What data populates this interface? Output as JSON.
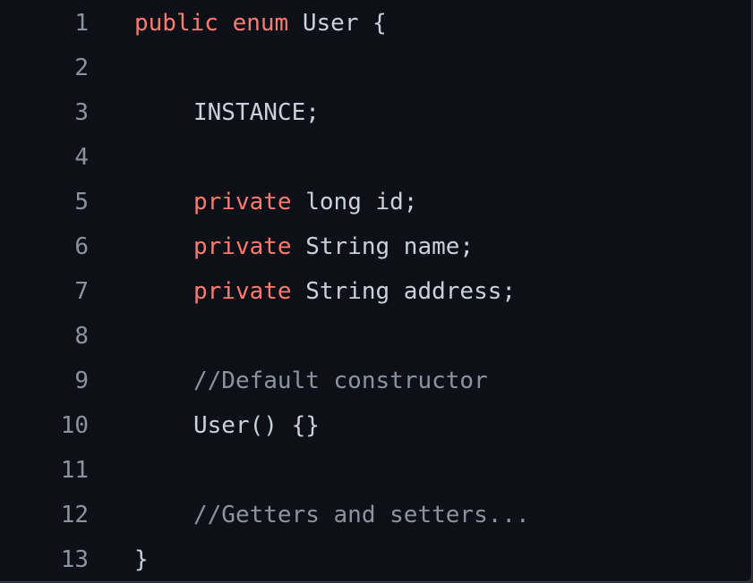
{
  "theme": {
    "background": "#0d1117",
    "line_number_color": "#8b949e",
    "keyword_color": "#ff7b72",
    "text_color": "#c9d1d9",
    "comment_color": "#8b949e"
  },
  "code": {
    "language": "java",
    "lines": [
      {
        "number": "1",
        "tokens": [
          {
            "type": "keyword",
            "text": "public"
          },
          {
            "type": "plain",
            "text": " "
          },
          {
            "type": "keyword",
            "text": "enum"
          },
          {
            "type": "plain",
            "text": " User {"
          }
        ]
      },
      {
        "number": "2",
        "tokens": []
      },
      {
        "number": "3",
        "tokens": [
          {
            "type": "plain",
            "text": "INSTANCE;"
          }
        ]
      },
      {
        "number": "4",
        "tokens": []
      },
      {
        "number": "5",
        "tokens": [
          {
            "type": "keyword",
            "text": "private"
          },
          {
            "type": "plain",
            "text": " long id;"
          }
        ]
      },
      {
        "number": "6",
        "tokens": [
          {
            "type": "keyword",
            "text": "private"
          },
          {
            "type": "plain",
            "text": " String name;"
          }
        ]
      },
      {
        "number": "7",
        "tokens": [
          {
            "type": "keyword",
            "text": "private"
          },
          {
            "type": "plain",
            "text": " String address;"
          }
        ]
      },
      {
        "number": "8",
        "tokens": []
      },
      {
        "number": "9",
        "tokens": [
          {
            "type": "comment",
            "text": "//Default constructor"
          }
        ]
      },
      {
        "number": "10",
        "tokens": [
          {
            "type": "plain",
            "text": "User() {}"
          }
        ]
      },
      {
        "number": "11",
        "tokens": []
      },
      {
        "number": "12",
        "tokens": [
          {
            "type": "comment",
            "text": "//Getters and setters..."
          }
        ]
      },
      {
        "number": "13",
        "tokens": [
          {
            "type": "plain",
            "text": "}"
          }
        ]
      }
    ]
  }
}
